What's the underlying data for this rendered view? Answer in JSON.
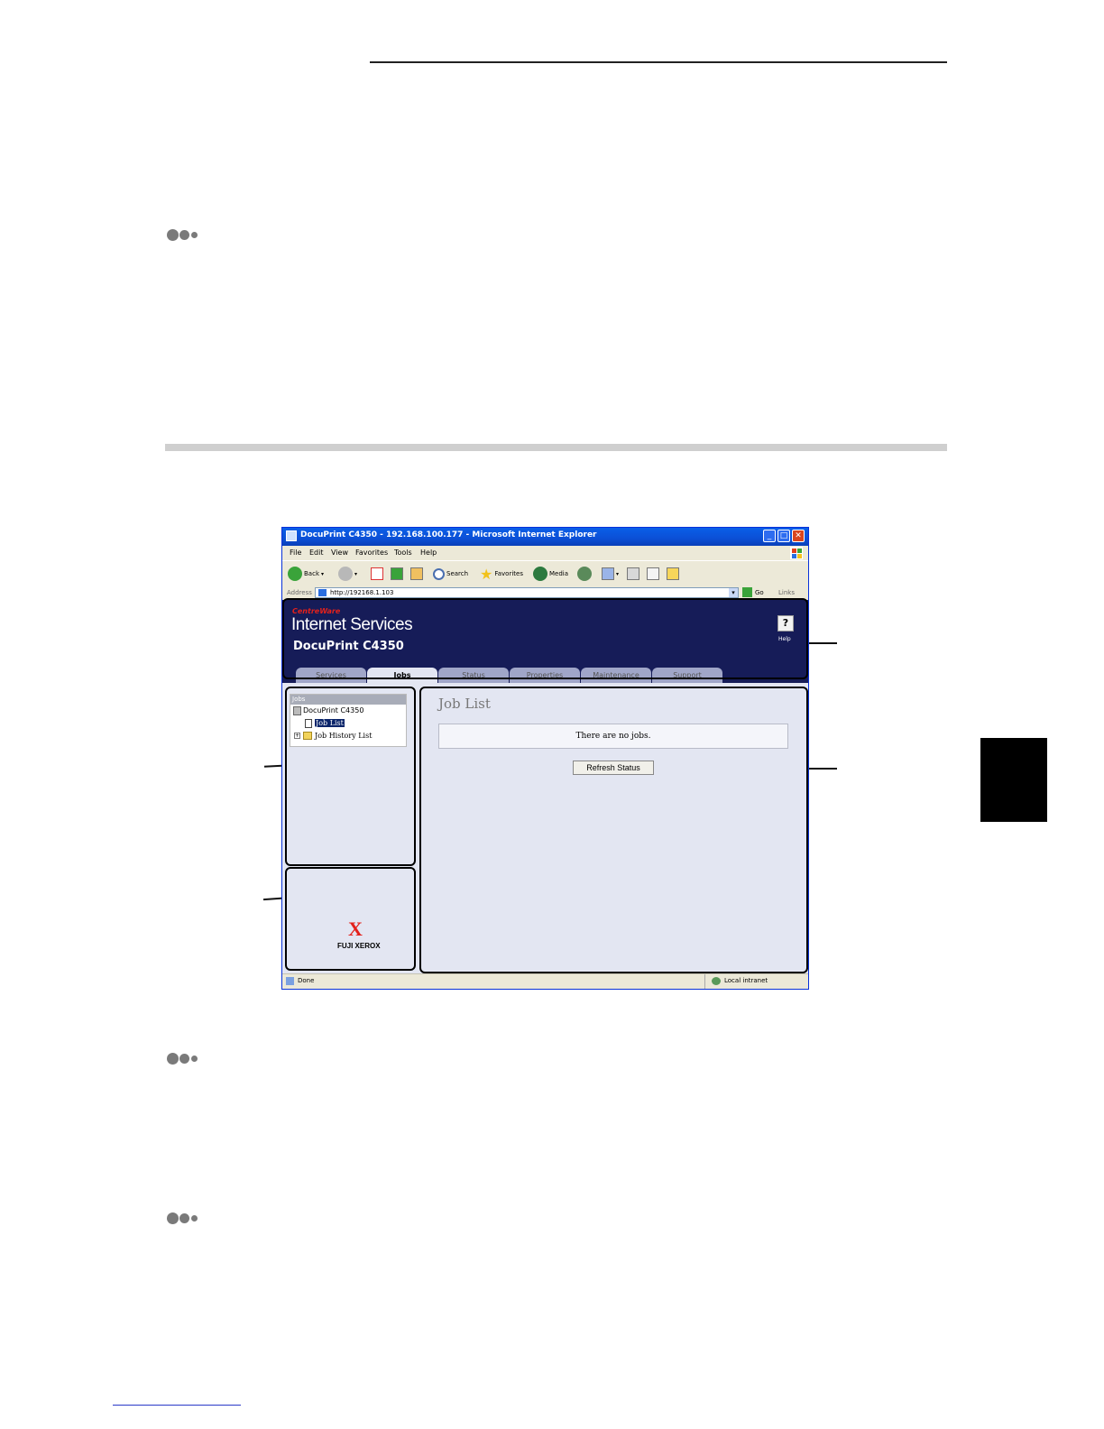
{
  "browser": {
    "title": "DocuPrint C4350 - 192.168.100.177 - Microsoft Internet Explorer",
    "menu": [
      "File",
      "Edit",
      "View",
      "Favorites",
      "Tools",
      "Help"
    ],
    "toolbar": {
      "back": "Back",
      "search": "Search",
      "favorites": "Favorites",
      "media": "Media"
    },
    "address_label": "Address",
    "address_value": "http://192168.1.103",
    "go": "Go",
    "links": "Links",
    "status_left": "Done",
    "status_right": "Local intranet"
  },
  "header": {
    "brand_small": "CentreWare",
    "brand": "Internet Services",
    "model": "DocuPrint C4350",
    "help": "Help",
    "tabs": [
      {
        "label": "Services",
        "active": false
      },
      {
        "label": "Jobs",
        "active": true
      },
      {
        "label": "Status",
        "active": false
      },
      {
        "label": "Properties",
        "active": false
      },
      {
        "label": "Maintenance",
        "active": false
      },
      {
        "label": "Support",
        "active": false
      }
    ]
  },
  "tree": {
    "header": "Jobs",
    "root": "DocuPrint C4350",
    "item1": "Job List",
    "item2": "Job History List"
  },
  "logo": {
    "mark": "X",
    "text": "FUJI XEROX"
  },
  "main": {
    "title": "Job List",
    "message": "There are no jobs.",
    "refresh": "Refresh Status"
  },
  "colors": {
    "header_bg": "#161c58",
    "content_bg": "#e3e6f2",
    "xerox_red": "#e3211b"
  }
}
